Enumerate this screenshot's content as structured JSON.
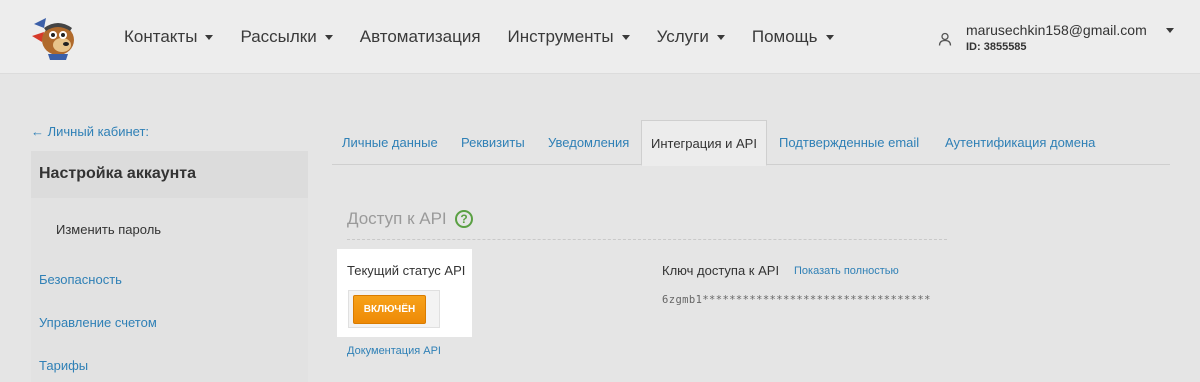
{
  "header": {
    "nav": [
      {
        "label": "Контакты",
        "has_caret": true
      },
      {
        "label": "Рассылки",
        "has_caret": true
      },
      {
        "label": "Автоматизация",
        "has_caret": false
      },
      {
        "label": "Инструменты",
        "has_caret": true
      },
      {
        "label": "Услуги",
        "has_caret": true
      },
      {
        "label": "Помощь",
        "has_caret": true
      }
    ],
    "user": {
      "email": "marusechkin158@gmail.com",
      "id": "ID: 3855585"
    }
  },
  "sidebar": {
    "back_link": "← Личный кабинет:",
    "title": "Настройка аккаунта",
    "sub_item": "Изменить пароль",
    "links": [
      "Безопасность",
      "Управление счетом",
      "Тарифы"
    ]
  },
  "tabs": [
    {
      "label": "Личные данные",
      "active": false
    },
    {
      "label": "Реквизиты",
      "active": false
    },
    {
      "label": "Уведомления",
      "active": false
    },
    {
      "label": "Интеграция и API",
      "active": true
    },
    {
      "label": "Подтвержденные email",
      "active": false
    },
    {
      "label": "Аутентификация домена",
      "active": false
    }
  ],
  "api": {
    "section_title": "Доступ к API",
    "help_glyph": "?",
    "status_label": "Текущий статус API",
    "status_button": "ВКЛЮЧЁН",
    "doc_link": "Документация API",
    "key_label": "Ключ доступа к API",
    "key_show": "Показать полностью",
    "key_value": "6zgmb1**********************************"
  },
  "colors": {
    "link": "#2f80b6",
    "status_button": "#f29a0f",
    "help_icon": "#5aa043"
  }
}
